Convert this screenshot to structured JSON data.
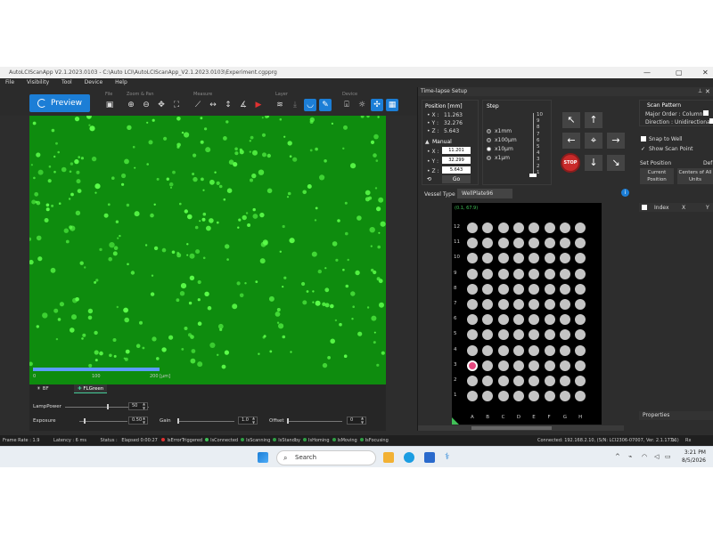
{
  "title": "AutoLCIScanApp V2.1.2023.0103 - C:\\Auto LCI\\AutoLCIScanApp_V2.1.2023.0103\\Experiment.cgpprg",
  "menu": [
    "File",
    "Visibility",
    "Tool",
    "Device",
    "Help"
  ],
  "toolbar": {
    "preview_label": "Preview",
    "groups": {
      "file": "File",
      "zoom": "Zoom & Pan",
      "measure": "Measure",
      "layer": "Layer",
      "device": "Device"
    }
  },
  "image_view": {
    "scale_labels": [
      "0",
      "100",
      "200 [µm]"
    ],
    "resolution": "Resolution : 2592 x 1944",
    "zoom": "Zoom : x1.0"
  },
  "channels": {
    "bf": "BF",
    "flgreen": "FLGreen"
  },
  "controls": {
    "lamp_label": "LampPower",
    "lamp_value": "50",
    "lamp_level": 0.5,
    "exposure_label": "Exposure",
    "exposure_value": "0.50",
    "exposure_level": 0.1,
    "gain_label": "Gain",
    "gain_value": "1.0",
    "gain_level": 0.0,
    "offset_label": "Offset",
    "offset_value": "0",
    "offset_level": 0.0
  },
  "status": {
    "frame_rate": "Frame Rate : 1.9",
    "latency": "Latency : 6 ms",
    "status": "Status :",
    "elapsed": "Elapsed 0:00:27",
    "indicators": [
      {
        "label": "IsErrorTriggered",
        "color": "#e03131"
      },
      {
        "label": "IsConnected",
        "color": "#40c057"
      },
      {
        "label": "IsScanning",
        "color": "#2f9e44"
      },
      {
        "label": "IsStandby",
        "color": "#2f9e44"
      },
      {
        "label": "IsHoming",
        "color": "#2f9e44"
      },
      {
        "label": "IsMoving",
        "color": "#2f9e44"
      },
      {
        "label": "IsFocusing",
        "color": "#2f9e44"
      }
    ],
    "connected": "Connected: 192.168.2.10, (S/N: LCI2306-07007, Ver. 2.1.17.11)",
    "tx": "Tx",
    "rx": "Rx"
  },
  "timelapse": {
    "title": "Time-lapse Setup",
    "position_title": "Position [mm]",
    "pos": {
      "x": "• X :",
      "xv": "11.263",
      "y": "• Y :",
      "yv": "32.276",
      "z": "• Z :",
      "zv": "5.643"
    },
    "manual": "Manual",
    "manual_vals": {
      "x": "11.201",
      "y": "32.299",
      "z": "5.643"
    },
    "go": "Go",
    "step_title": "Step",
    "steps": [
      "x1mm",
      "x100µm",
      "x10µm",
      "x1µm"
    ],
    "step_selected": 2,
    "ruler": [
      "10",
      "9",
      "8",
      "7",
      "6",
      "5",
      "4",
      "3",
      "2",
      "1"
    ],
    "stop": "STOP",
    "scan_pattern": "Scan Pattern",
    "major_order": "Major Order : Column",
    "direction": "Direction : Unidirectional",
    "snap": "Snap to Well",
    "show_scan": "Show Scan Point",
    "set_position": "Set Position",
    "def": "Def",
    "current_position": "Current Position",
    "centers": "Centers of All Units",
    "index": "Index",
    "x_col": "X",
    "y_col": "Y",
    "vessel_type_label": "Vessel Type",
    "vessel_type": "WellPlate96",
    "coord_readout": "(0.1, 67.9)",
    "row_labels": [
      "12",
      "11",
      "10",
      "9",
      "8",
      "7",
      "6",
      "5",
      "4",
      "3",
      "2",
      "1"
    ],
    "col_labels": [
      "A",
      "B",
      "C",
      "D",
      "E",
      "F",
      "G",
      "H"
    ],
    "selected_well": {
      "column": "A",
      "row": "3"
    },
    "properties": "Properties"
  },
  "taskbar": {
    "search": "Search",
    "time": "3:21 PM",
    "date": "8/5/2026"
  }
}
